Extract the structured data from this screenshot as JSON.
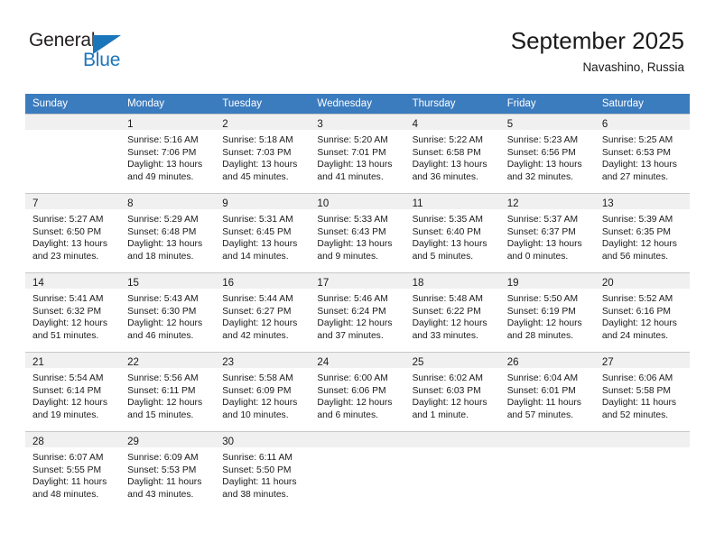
{
  "logo": {
    "word_one": "General",
    "word_two": "Blue",
    "triangle_color": "#1b75bb",
    "text_color": "#231f20"
  },
  "header": {
    "title": "September 2025",
    "subtitle": "Navashino, Russia"
  },
  "theme": {
    "header_bg": "#3b7cbf",
    "daynum_bg": "#f0f0f0",
    "grid_line": "#c8c8c8",
    "text": "#1a1a1a"
  },
  "weekdays": [
    "Sunday",
    "Monday",
    "Tuesday",
    "Wednesday",
    "Thursday",
    "Friday",
    "Saturday"
  ],
  "weeks": [
    [
      {
        "day": "",
        "sunrise": "",
        "sunset": "",
        "daylight_1": "",
        "daylight_2": ""
      },
      {
        "day": "1",
        "sunrise": "Sunrise: 5:16 AM",
        "sunset": "Sunset: 7:06 PM",
        "daylight_1": "Daylight: 13 hours",
        "daylight_2": "and 49 minutes."
      },
      {
        "day": "2",
        "sunrise": "Sunrise: 5:18 AM",
        "sunset": "Sunset: 7:03 PM",
        "daylight_1": "Daylight: 13 hours",
        "daylight_2": "and 45 minutes."
      },
      {
        "day": "3",
        "sunrise": "Sunrise: 5:20 AM",
        "sunset": "Sunset: 7:01 PM",
        "daylight_1": "Daylight: 13 hours",
        "daylight_2": "and 41 minutes."
      },
      {
        "day": "4",
        "sunrise": "Sunrise: 5:22 AM",
        "sunset": "Sunset: 6:58 PM",
        "daylight_1": "Daylight: 13 hours",
        "daylight_2": "and 36 minutes."
      },
      {
        "day": "5",
        "sunrise": "Sunrise: 5:23 AM",
        "sunset": "Sunset: 6:56 PM",
        "daylight_1": "Daylight: 13 hours",
        "daylight_2": "and 32 minutes."
      },
      {
        "day": "6",
        "sunrise": "Sunrise: 5:25 AM",
        "sunset": "Sunset: 6:53 PM",
        "daylight_1": "Daylight: 13 hours",
        "daylight_2": "and 27 minutes."
      }
    ],
    [
      {
        "day": "7",
        "sunrise": "Sunrise: 5:27 AM",
        "sunset": "Sunset: 6:50 PM",
        "daylight_1": "Daylight: 13 hours",
        "daylight_2": "and 23 minutes."
      },
      {
        "day": "8",
        "sunrise": "Sunrise: 5:29 AM",
        "sunset": "Sunset: 6:48 PM",
        "daylight_1": "Daylight: 13 hours",
        "daylight_2": "and 18 minutes."
      },
      {
        "day": "9",
        "sunrise": "Sunrise: 5:31 AM",
        "sunset": "Sunset: 6:45 PM",
        "daylight_1": "Daylight: 13 hours",
        "daylight_2": "and 14 minutes."
      },
      {
        "day": "10",
        "sunrise": "Sunrise: 5:33 AM",
        "sunset": "Sunset: 6:43 PM",
        "daylight_1": "Daylight: 13 hours",
        "daylight_2": "and 9 minutes."
      },
      {
        "day": "11",
        "sunrise": "Sunrise: 5:35 AM",
        "sunset": "Sunset: 6:40 PM",
        "daylight_1": "Daylight: 13 hours",
        "daylight_2": "and 5 minutes."
      },
      {
        "day": "12",
        "sunrise": "Sunrise: 5:37 AM",
        "sunset": "Sunset: 6:37 PM",
        "daylight_1": "Daylight: 13 hours",
        "daylight_2": "and 0 minutes."
      },
      {
        "day": "13",
        "sunrise": "Sunrise: 5:39 AM",
        "sunset": "Sunset: 6:35 PM",
        "daylight_1": "Daylight: 12 hours",
        "daylight_2": "and 56 minutes."
      }
    ],
    [
      {
        "day": "14",
        "sunrise": "Sunrise: 5:41 AM",
        "sunset": "Sunset: 6:32 PM",
        "daylight_1": "Daylight: 12 hours",
        "daylight_2": "and 51 minutes."
      },
      {
        "day": "15",
        "sunrise": "Sunrise: 5:43 AM",
        "sunset": "Sunset: 6:30 PM",
        "daylight_1": "Daylight: 12 hours",
        "daylight_2": "and 46 minutes."
      },
      {
        "day": "16",
        "sunrise": "Sunrise: 5:44 AM",
        "sunset": "Sunset: 6:27 PM",
        "daylight_1": "Daylight: 12 hours",
        "daylight_2": "and 42 minutes."
      },
      {
        "day": "17",
        "sunrise": "Sunrise: 5:46 AM",
        "sunset": "Sunset: 6:24 PM",
        "daylight_1": "Daylight: 12 hours",
        "daylight_2": "and 37 minutes."
      },
      {
        "day": "18",
        "sunrise": "Sunrise: 5:48 AM",
        "sunset": "Sunset: 6:22 PM",
        "daylight_1": "Daylight: 12 hours",
        "daylight_2": "and 33 minutes."
      },
      {
        "day": "19",
        "sunrise": "Sunrise: 5:50 AM",
        "sunset": "Sunset: 6:19 PM",
        "daylight_1": "Daylight: 12 hours",
        "daylight_2": "and 28 minutes."
      },
      {
        "day": "20",
        "sunrise": "Sunrise: 5:52 AM",
        "sunset": "Sunset: 6:16 PM",
        "daylight_1": "Daylight: 12 hours",
        "daylight_2": "and 24 minutes."
      }
    ],
    [
      {
        "day": "21",
        "sunrise": "Sunrise: 5:54 AM",
        "sunset": "Sunset: 6:14 PM",
        "daylight_1": "Daylight: 12 hours",
        "daylight_2": "and 19 minutes."
      },
      {
        "day": "22",
        "sunrise": "Sunrise: 5:56 AM",
        "sunset": "Sunset: 6:11 PM",
        "daylight_1": "Daylight: 12 hours",
        "daylight_2": "and 15 minutes."
      },
      {
        "day": "23",
        "sunrise": "Sunrise: 5:58 AM",
        "sunset": "Sunset: 6:09 PM",
        "daylight_1": "Daylight: 12 hours",
        "daylight_2": "and 10 minutes."
      },
      {
        "day": "24",
        "sunrise": "Sunrise: 6:00 AM",
        "sunset": "Sunset: 6:06 PM",
        "daylight_1": "Daylight: 12 hours",
        "daylight_2": "and 6 minutes."
      },
      {
        "day": "25",
        "sunrise": "Sunrise: 6:02 AM",
        "sunset": "Sunset: 6:03 PM",
        "daylight_1": "Daylight: 12 hours",
        "daylight_2": "and 1 minute."
      },
      {
        "day": "26",
        "sunrise": "Sunrise: 6:04 AM",
        "sunset": "Sunset: 6:01 PM",
        "daylight_1": "Daylight: 11 hours",
        "daylight_2": "and 57 minutes."
      },
      {
        "day": "27",
        "sunrise": "Sunrise: 6:06 AM",
        "sunset": "Sunset: 5:58 PM",
        "daylight_1": "Daylight: 11 hours",
        "daylight_2": "and 52 minutes."
      }
    ],
    [
      {
        "day": "28",
        "sunrise": "Sunrise: 6:07 AM",
        "sunset": "Sunset: 5:55 PM",
        "daylight_1": "Daylight: 11 hours",
        "daylight_2": "and 48 minutes."
      },
      {
        "day": "29",
        "sunrise": "Sunrise: 6:09 AM",
        "sunset": "Sunset: 5:53 PM",
        "daylight_1": "Daylight: 11 hours",
        "daylight_2": "and 43 minutes."
      },
      {
        "day": "30",
        "sunrise": "Sunrise: 6:11 AM",
        "sunset": "Sunset: 5:50 PM",
        "daylight_1": "Daylight: 11 hours",
        "daylight_2": "and 38 minutes."
      },
      {
        "day": "",
        "sunrise": "",
        "sunset": "",
        "daylight_1": "",
        "daylight_2": ""
      },
      {
        "day": "",
        "sunrise": "",
        "sunset": "",
        "daylight_1": "",
        "daylight_2": ""
      },
      {
        "day": "",
        "sunrise": "",
        "sunset": "",
        "daylight_1": "",
        "daylight_2": ""
      },
      {
        "day": "",
        "sunrise": "",
        "sunset": "",
        "daylight_1": "",
        "daylight_2": ""
      }
    ]
  ]
}
